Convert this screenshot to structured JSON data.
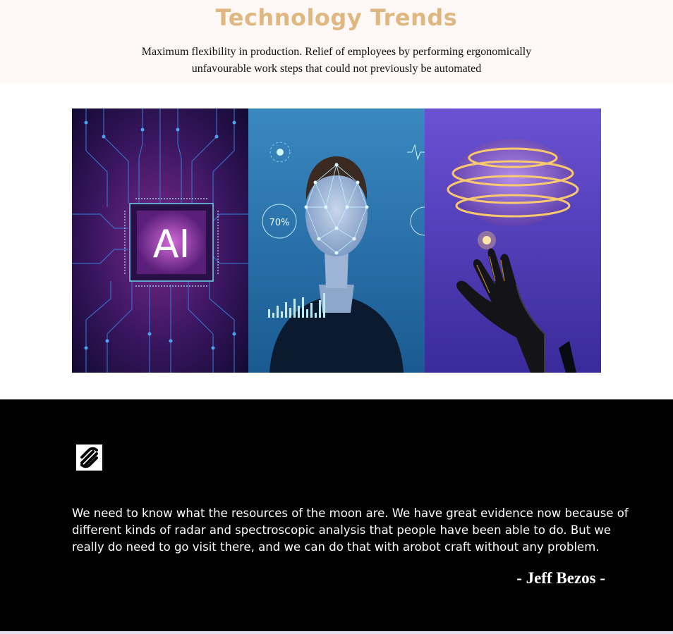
{
  "header": {
    "title": "Technology Trends",
    "subtitle": "Maximum flexibility in production. Relief of employees by performing ergonomically unfavourable work steps that could not previously be automated"
  },
  "gallery": {
    "images": [
      {
        "name": "ai-chip-image",
        "chip_text": "AI"
      },
      {
        "name": "face-recognition-image",
        "badge_text": "70%"
      },
      {
        "name": "robot-hand-brain-image"
      }
    ]
  },
  "quote": {
    "logo_icon": "squarespace-logo-icon",
    "text": "We need to know what the resources of the moon are. We have great evidence now because of different kinds of radar and spectroscopic analysis that people have been able to do. But we really do need to go visit there, and we can do that with arobot craft without any problem.",
    "author": "- Jeff Bezos -"
  },
  "colors": {
    "title": "#dfb780",
    "header_bg": "#fdf8f5",
    "quote_bg": "#000000",
    "quote_text": "#ffffff"
  }
}
